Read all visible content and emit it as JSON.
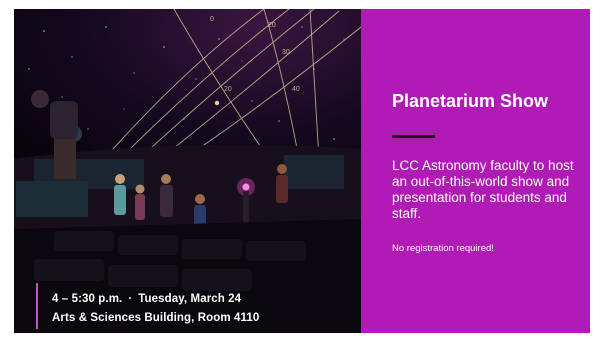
{
  "slide": {
    "title": "Planetarium Show",
    "description": "LCC Astronomy faculty to host an out-of-this-world show and presentation for students and staff.",
    "note": "No registration required!",
    "time": "4 – 5:30 p.m.",
    "date": "Tuesday, March 24",
    "location": "Arts & Sciences Building, Room 4110",
    "separator": "·"
  },
  "dome_grid_labels": [
    "20",
    "30",
    "40",
    "0",
    "20"
  ],
  "colors": {
    "panel": "#b01bb6",
    "accent_rule": "#c94fd1",
    "title_rule": "#1a0a1c"
  }
}
